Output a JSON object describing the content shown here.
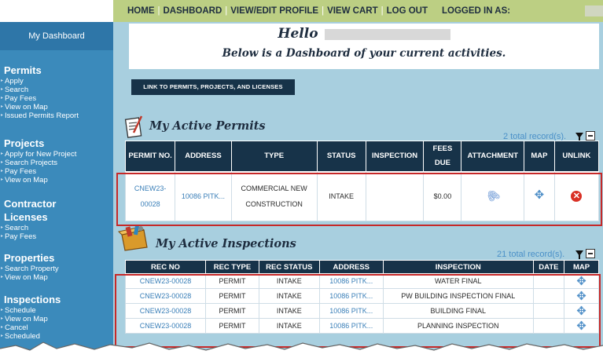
{
  "topbar": {
    "home": "HOME",
    "dashboard": "DASHBOARD",
    "profile": "VIEW/EDIT PROFILE",
    "cart": "VIEW CART",
    "logout": "LOG OUT",
    "logged_in": "LOGGED IN AS:",
    "separator": "|"
  },
  "sidebar": {
    "dashboard": "My Dashboard",
    "sections": [
      {
        "title": "Permits",
        "links": [
          "Apply",
          "Search",
          "Pay Fees",
          "View on Map",
          "Issued Permits Report"
        ]
      },
      {
        "title": "Projects",
        "links": [
          "Apply for New Project",
          "Search Projects",
          "Pay Fees",
          "View on Map"
        ]
      },
      {
        "title": "Contractor",
        "title2": "Licenses",
        "links": [
          "Search",
          "Pay Fees"
        ]
      },
      {
        "title": "Properties",
        "links": [
          "Search Property",
          "View on Map"
        ]
      },
      {
        "title": "Inspections",
        "links": [
          "Schedule",
          "View on Map",
          "Cancel",
          "Scheduled"
        ]
      }
    ]
  },
  "main": {
    "hello": "Hello",
    "subtitle": "Below is a Dashboard of your current activities.",
    "link_button": "LINK TO PERMITS, PROJECTS, AND LICENSES"
  },
  "permits": {
    "heading": "My Active Permits",
    "records": "2 total record(s).",
    "columns": [
      "PERMIT NO.",
      "ADDRESS",
      "TYPE",
      "STATUS",
      "INSPECTION",
      "FEES DUE",
      "ATTACHMENT",
      "MAP",
      "UNLINK"
    ],
    "row": {
      "permit_no": "CNEW23-00028",
      "address": "10086 PITK...",
      "type": "COMMERCIAL NEW CONSTRUCTION",
      "status": "INTAKE",
      "inspection": "",
      "fees_due": "$0.00"
    }
  },
  "inspections": {
    "heading": "My Active Inspections",
    "records": "21 total record(s).",
    "columns": [
      "REC NO",
      "REC TYPE",
      "REC STATUS",
      "ADDRESS",
      "INSPECTION",
      "DATE",
      "MAP"
    ],
    "rows": [
      {
        "rec_no": "CNEW23-00028",
        "rec_type": "PERMIT",
        "rec_status": "INTAKE",
        "address": "10086 PITK...",
        "inspection": "WATER FINAL",
        "date": ""
      },
      {
        "rec_no": "CNEW23-00028",
        "rec_type": "PERMIT",
        "rec_status": "INTAKE",
        "address": "10086 PITK...",
        "inspection": "PW BUILDING INSPECTION FINAL",
        "date": ""
      },
      {
        "rec_no": "CNEW23-00028",
        "rec_type": "PERMIT",
        "rec_status": "INTAKE",
        "address": "10086 PITK...",
        "inspection": "BUILDING FINAL",
        "date": ""
      },
      {
        "rec_no": "CNEW23-00028",
        "rec_type": "PERMIT",
        "rec_status": "INTAKE",
        "address": "10086 PITK...",
        "inspection": "PLANNING INSPECTION",
        "date": ""
      }
    ]
  },
  "icons": {
    "attachment": "paperclip-icon",
    "map": "move-icon",
    "unlink": "delete-icon",
    "filter": "filter-icon",
    "minimize": "minimize-icon"
  },
  "colors": {
    "topbar": "#bccf83",
    "sidebar": "#3b8abb",
    "content_bg": "#a8cfdf",
    "table_header": "#173349",
    "link": "#3a7fb8",
    "highlight": "#c62828"
  }
}
